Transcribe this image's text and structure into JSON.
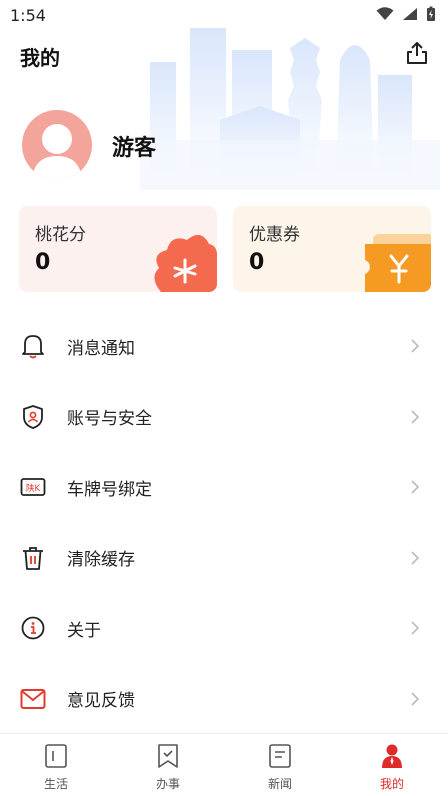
{
  "status_bar": {
    "time": "1:54"
  },
  "header": {
    "title": "我的"
  },
  "profile": {
    "name": "游客"
  },
  "cards": [
    {
      "label": "桃花分",
      "value": "0",
      "icon": "peach-blossom-icon",
      "color": "#f36a4f"
    },
    {
      "label": "优惠券",
      "value": "0",
      "icon": "yuan-coupon-icon",
      "color": "#f59a23"
    }
  ],
  "menu": [
    {
      "label": "消息通知",
      "icon": "bell-icon"
    },
    {
      "label": "账号与安全",
      "icon": "shield-user-icon"
    },
    {
      "label": "车牌号绑定",
      "icon": "license-plate-icon",
      "plate_text": "陕K"
    },
    {
      "label": "清除缓存",
      "icon": "trash-icon"
    },
    {
      "label": "关于",
      "icon": "info-icon"
    },
    {
      "label": "意见反馈",
      "icon": "mail-icon"
    }
  ],
  "tabs": [
    {
      "label": "生活",
      "icon": "life-icon",
      "active": false
    },
    {
      "label": "办事",
      "icon": "bookmark-check-icon",
      "active": false
    },
    {
      "label": "新闻",
      "icon": "news-doc-icon",
      "active": false
    },
    {
      "label": "我的",
      "icon": "person-icon",
      "active": true
    }
  ],
  "colors": {
    "accent": "#e02b2b",
    "icon_red": "#e23b2e"
  }
}
